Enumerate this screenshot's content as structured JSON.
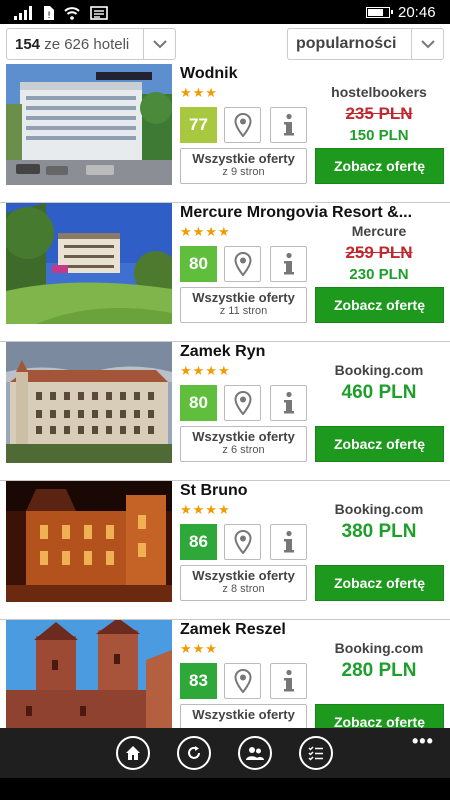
{
  "status_bar": {
    "time": "20:46",
    "battery_level": 0.8
  },
  "filter": {
    "count_bold": "154",
    "count_rest": " ze 626 hoteli",
    "sort_label": "popularności"
  },
  "hotels": [
    {
      "name": "Wodnik",
      "stars": "★★★",
      "score": "77",
      "score_color": "#a8c840",
      "offers_label": "Wszystkie oferty",
      "offers_sub": "z 9 stron",
      "provider": "hostelbookers",
      "old_price": "235 PLN",
      "price": "150 PLN",
      "cta": "Zobacz ofertę",
      "image": "hotel-building-photo"
    },
    {
      "name": "Mercure Mrongovia Resort &...",
      "stars": "★★★★",
      "score": "80",
      "score_color": "#5fbf3c",
      "offers_label": "Wszystkie oferty",
      "offers_sub": "z 11 stron",
      "provider": "Mercure",
      "old_price": "259 PLN",
      "price": "230 PLN",
      "cta": "Zobacz ofertę",
      "image": "resort-garden-photo"
    },
    {
      "name": "Zamek Ryn",
      "stars": "★★★★",
      "score": "80",
      "score_color": "#5fbf3c",
      "offers_label": "Wszystkie oferty",
      "offers_sub": "z 6 stron",
      "provider": "Booking.com",
      "price": "460 PLN",
      "cta": "Zobacz ofertę",
      "image": "castle-photo"
    },
    {
      "name": "St Bruno",
      "stars": "★★★★",
      "score": "86",
      "score_color": "#2fa83a",
      "offers_label": "Wszystkie oferty",
      "offers_sub": "z 8 stron",
      "provider": "Booking.com",
      "price": "380 PLN",
      "cta": "Zobacz ofertę",
      "image": "night-castle-photo"
    },
    {
      "name": "Zamek Reszel",
      "stars": "★★★",
      "score": "83",
      "score_color": "#2fa83a",
      "offers_label": "Wszystkie oferty",
      "offers_sub": "",
      "provider": "Booking.com",
      "price": "280 PLN",
      "cta": "Zobacz ofertę",
      "image": "brick-castle-photo"
    }
  ],
  "app_bar": {
    "buttons": [
      "home-icon",
      "refresh-icon",
      "people-icon",
      "checklist-icon"
    ],
    "more": "•••"
  }
}
